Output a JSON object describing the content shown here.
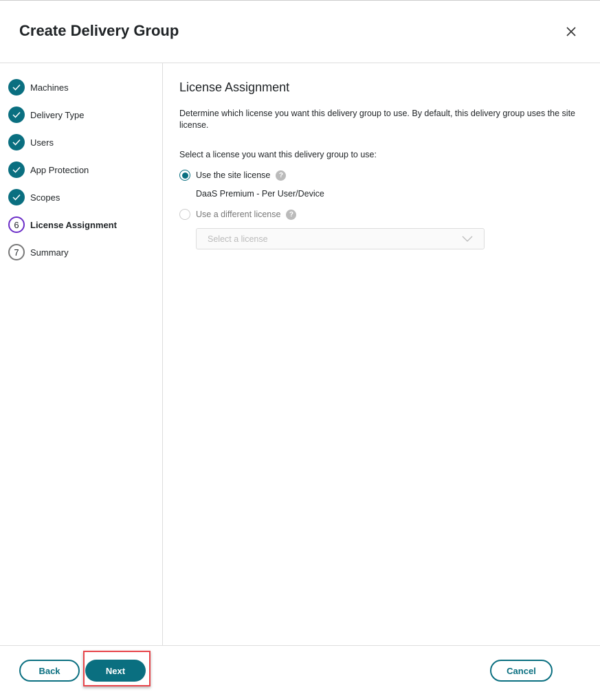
{
  "dialog": {
    "title": "Create Delivery Group"
  },
  "steps": [
    {
      "number": "1",
      "label": "Machines",
      "status": "done"
    },
    {
      "number": "2",
      "label": "Delivery Type",
      "status": "done"
    },
    {
      "number": "3",
      "label": "Users",
      "status": "done"
    },
    {
      "number": "4",
      "label": "App Protection",
      "status": "done"
    },
    {
      "number": "5",
      "label": "Scopes",
      "status": "done"
    },
    {
      "number": "6",
      "label": "License Assignment",
      "status": "current"
    },
    {
      "number": "7",
      "label": "Summary",
      "status": "todo"
    }
  ],
  "main": {
    "heading": "License Assignment",
    "description": "Determine which license you want this delivery group to use. By default, this delivery group uses the site license.",
    "prompt": "Select a license you want this delivery group to use:",
    "option_site": "Use the site license",
    "site_license_name": "DaaS Premium - Per User/Device",
    "option_different": "Use a different license",
    "select_placeholder": "Select a license",
    "help": "?"
  },
  "footer": {
    "back": "Back",
    "next": "Next",
    "cancel": "Cancel"
  },
  "colors": {
    "accent": "#0a6f80",
    "current_step": "#6a2cc7",
    "highlight": "#e8444a"
  }
}
